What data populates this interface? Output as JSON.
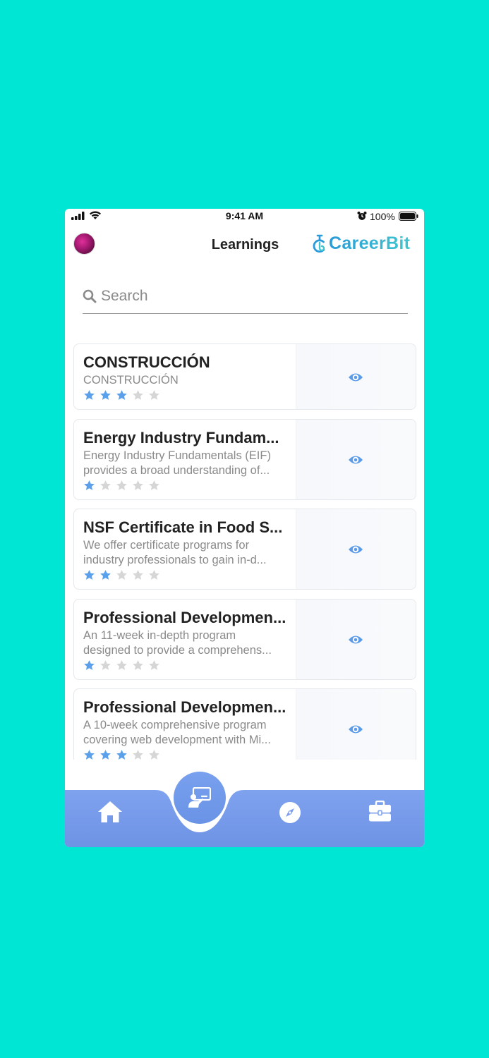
{
  "status_bar": {
    "time": "9:41 AM",
    "battery": "100%"
  },
  "header": {
    "title": "Learnings",
    "brand": "CareerBit"
  },
  "search": {
    "placeholder": "Search"
  },
  "courses": [
    {
      "title": "CONSTRUCCIÓN",
      "desc1": "CONSTRUCCIÓN",
      "desc2": "",
      "rating": 3
    },
    {
      "title": "Energy Industry Fundam...",
      "desc1": "Energy Industry Fundamentals (EIF)",
      "desc2": "provides a broad understanding of...",
      "rating": 1
    },
    {
      "title": "NSF Certificate in Food S...",
      "desc1": "We offer certificate programs for",
      "desc2": "industry professionals to gain in-d...",
      "rating": 2
    },
    {
      "title": "Professional Developmen...",
      "desc1": "An 11-week in-depth program",
      "desc2": "designed to provide a comprehens...",
      "rating": 1
    },
    {
      "title": "Professional Developmen...",
      "desc1": "A 10-week comprehensive program",
      "desc2": "covering web development with Mi...",
      "rating": 3
    }
  ],
  "rating_max": 5,
  "colors": {
    "background": "#00e6d4",
    "accent": "#5b9be8",
    "star_on": "#5aa0ea",
    "star_off": "#d6d6d6",
    "tabbar": "#7a9cec"
  },
  "tabs": [
    {
      "icon": "home-icon",
      "active": false
    },
    {
      "icon": "learning-icon",
      "active": true
    },
    {
      "icon": "compass-icon",
      "active": false
    },
    {
      "icon": "briefcase-icon",
      "active": false
    }
  ]
}
